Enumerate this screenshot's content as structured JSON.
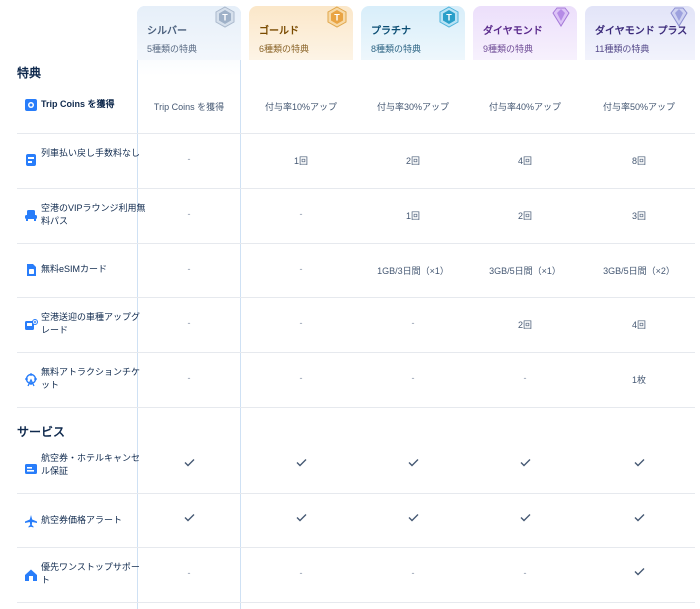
{
  "tiers": [
    {
      "name": "シルバー",
      "count": "5種類の特典",
      "color": "#4a5f7c"
    },
    {
      "name": "ゴールド",
      "count": "6種類の特典",
      "color": "#7a4b00"
    },
    {
      "name": "プラチナ",
      "count": "8種類の特典",
      "color": "#0b4e74"
    },
    {
      "name": "ダイヤモンド",
      "count": "9種類の特典",
      "color": "#5a2a8c"
    },
    {
      "name": "ダイヤモンド プラス",
      "count": "11種類の特典",
      "color": "#3b2a7a"
    }
  ],
  "sections": {
    "perks": "特典",
    "services": "サービス"
  },
  "rows": [
    {
      "label": "Trip Coins を獲得",
      "cells": [
        "Trip Coins を獲得",
        "付与率10%アップ",
        "付与率30%アップ",
        "付与率40%アップ",
        "付与率50%アップ"
      ]
    },
    {
      "label": "列車払い戻し手数料なし",
      "cells": [
        "-",
        "1回",
        "2回",
        "4回",
        "8回"
      ]
    },
    {
      "label": "空港のVIPラウンジ利用無料パス",
      "cells": [
        "-",
        "-",
        "1回",
        "2回",
        "3回"
      ]
    },
    {
      "label": "無料eSIMカード",
      "cells": [
        "-",
        "-",
        "1GB/3日間（×1）",
        "3GB/5日間（×1）",
        "3GB/5日間（×2）"
      ]
    },
    {
      "label": "空港送迎の車種アップグレード",
      "cells": [
        "-",
        "-",
        "-",
        "2回",
        "4回"
      ]
    },
    {
      "label": "無料アトラクションチケット",
      "cells": [
        "-",
        "-",
        "-",
        "-",
        "1枚"
      ]
    }
  ],
  "service_rows": [
    {
      "label": "航空券・ホテルキャンセル保証",
      "cells": [
        "check",
        "check",
        "check",
        "check",
        "check"
      ]
    },
    {
      "label": "航空券価格アラート",
      "cells": [
        "check",
        "check",
        "check",
        "check",
        "check"
      ]
    },
    {
      "label": "優先ワンストップサポート",
      "cells": [
        "-",
        "-",
        "-",
        "-",
        "check"
      ]
    }
  ],
  "colors": {
    "silver_bg": "#eef4fc",
    "gold_bg": "#fdf1e0",
    "platinum_bg": "#e9f5fc",
    "diamond_bg": "#f4eefc",
    "diamond_plus_bg": "#eef0fb",
    "brand_blue": "#287dfa"
  }
}
